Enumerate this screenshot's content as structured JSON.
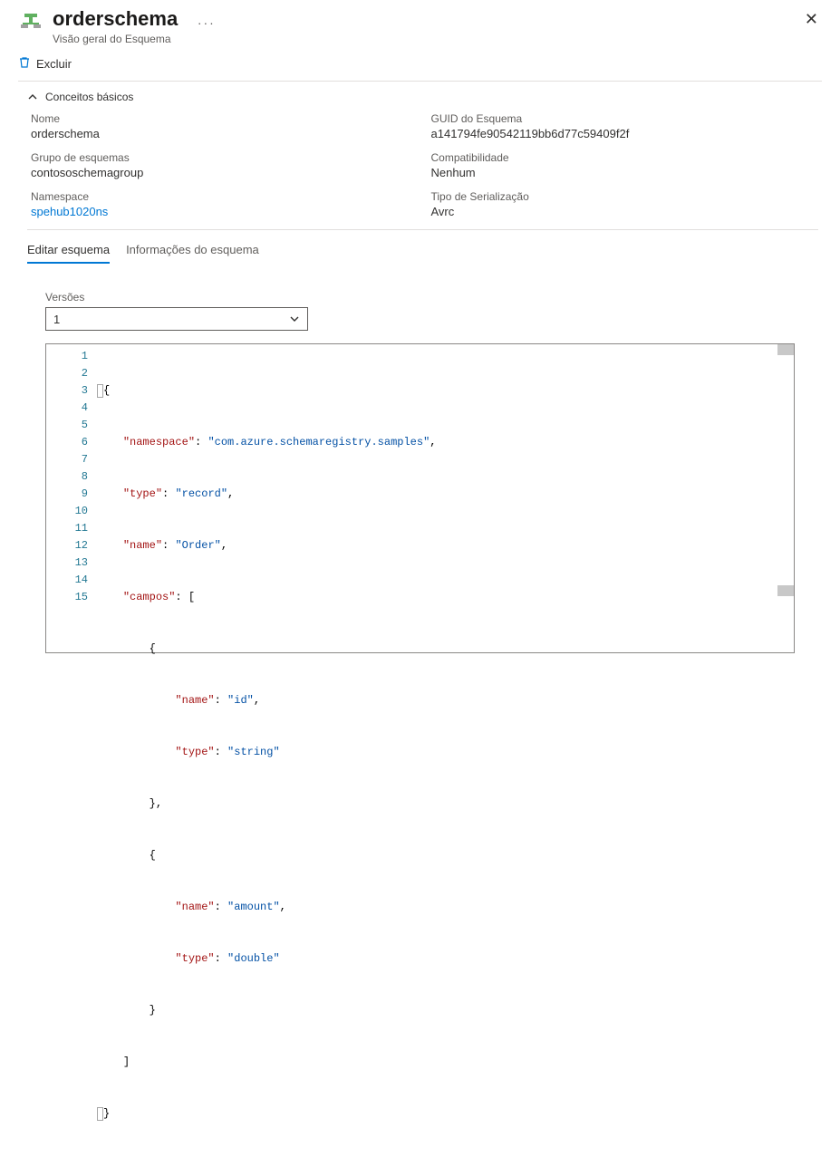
{
  "header": {
    "title": "orderschema",
    "ellipsis": "···",
    "subtitle": "Visão geral do Esquema"
  },
  "toolbar": {
    "delete_label": "Excluir"
  },
  "basics": {
    "header": "Conceitos básicos",
    "name_label": "Nome",
    "name_value": "orderschema",
    "guid_label": "GUID do Esquema",
    "guid_value": "a141794fe90542119bb6d77c59409f2f",
    "group_label": "Grupo de esquemas",
    "group_value": "contososchemagroup",
    "compat_label": "Compatibilidade",
    "compat_value": "Nenhum",
    "ns_label": "Namespace",
    "ns_value": "spehub1020ns",
    "serial_label": "Tipo de Serialização",
    "serial_value": "Avrc"
  },
  "tabs": {
    "edit": "Editar esquema",
    "info": "Informações do esquema"
  },
  "versions": {
    "label": "Versões",
    "selected": "1"
  },
  "editor": {
    "lines": [
      "1",
      "2",
      "3",
      "4",
      "5",
      "6",
      "7",
      "8",
      "9",
      "10",
      "11",
      "12",
      "13",
      "14",
      "15"
    ]
  },
  "schema_tokens": {
    "k_namespace": "\"namespace\"",
    "v_namespace": "\"com.azure.schemaregistry.samples\"",
    "k_type": "\"type\"",
    "v_record": "\"record\"",
    "k_name": "\"name\"",
    "v_order": "\"Order\"",
    "k_campos": "\"campos\"",
    "v_id": "\"id\"",
    "v_string": "\"string\"",
    "v_amount": "\"amount\"",
    "v_double": "\"double\""
  }
}
